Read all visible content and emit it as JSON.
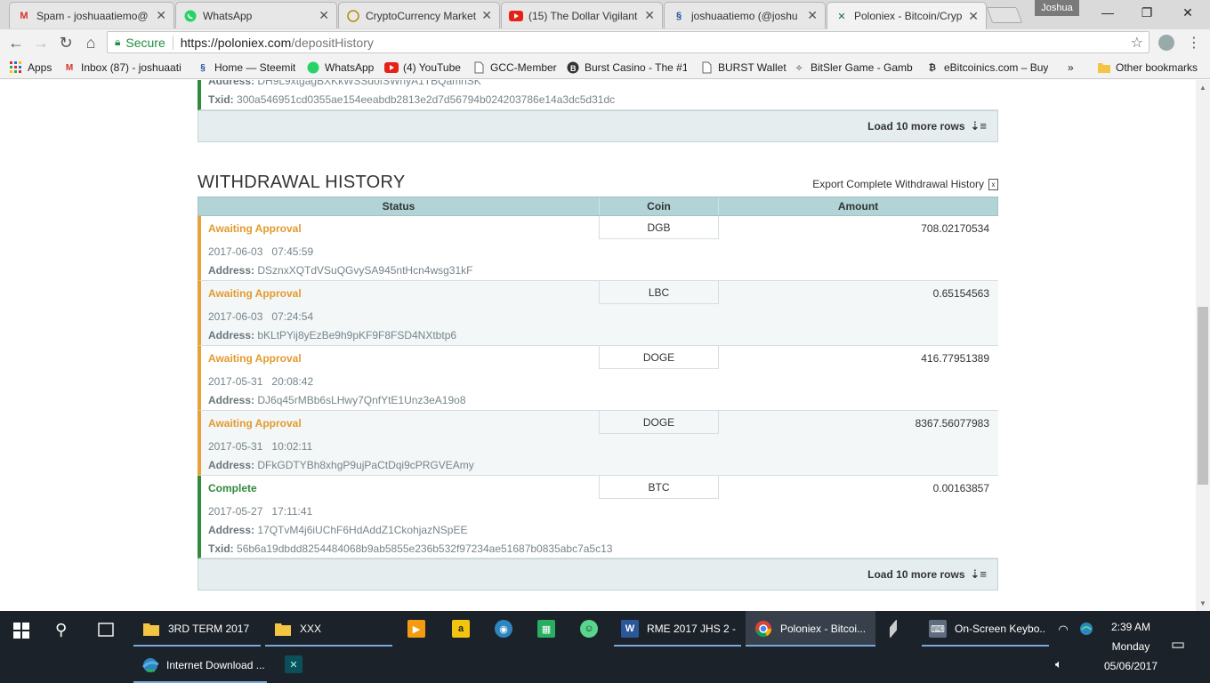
{
  "browser": {
    "tabs": [
      {
        "title": "Spam - joshuaatiemo@",
        "icon": "gmail-icon",
        "color": "#d93025"
      },
      {
        "title": "WhatsApp",
        "icon": "whatsapp-icon",
        "color": "#25d366"
      },
      {
        "title": "CryptoCurrency Market",
        "icon": "coin-icon",
        "color": "#b8860b"
      },
      {
        "title": "(15) The Dollar Vigilant",
        "icon": "youtube-icon",
        "color": "#e62117"
      },
      {
        "title": "joshuaatiemo (@joshu",
        "icon": "steemit-icon",
        "color": "#1a5099"
      },
      {
        "title": "Poloniex - Bitcoin/Cryp",
        "icon": "poloniex-icon",
        "color": "#0b6b6b"
      }
    ],
    "profile_name": "Joshua",
    "address": {
      "secure_label": "Secure",
      "url_host": "https://poloniex.com",
      "url_path": "/depositHistory"
    },
    "bookmarks": [
      {
        "label": "Apps",
        "icon": "apps-grid-icon"
      },
      {
        "label": "Inbox (87) - joshuaati",
        "icon": "gmail-icon"
      },
      {
        "label": "Home — Steemit",
        "icon": "steemit-icon"
      },
      {
        "label": "WhatsApp",
        "icon": "whatsapp-icon"
      },
      {
        "label": "(4) YouTube",
        "icon": "youtube-icon"
      },
      {
        "label": "GCC-Member",
        "icon": "page-icon"
      },
      {
        "label": "Burst Casino - The #1",
        "icon": "burst-casino-icon"
      },
      {
        "label": "BURST Wallet",
        "icon": "page-icon"
      },
      {
        "label": "BitSler Game - Gambl",
        "icon": "bitsler-icon"
      },
      {
        "label": "eBitcoinics.com – Buy",
        "icon": "ebitcoinics-icon"
      },
      {
        "label": "Other bookmarks",
        "icon": "folder-icon"
      }
    ],
    "more_bookmarks": "»"
  },
  "page": {
    "deposit_tail": {
      "address_label": "Address:",
      "address_value": "DH9L9xtgagBXKkWSSdofSWnyA1TBQamnSK",
      "txid_label": "Txid:",
      "txid_value": "300a546951cd0355ae154eeabdb2813e2d7d56794b024203786e14a3dc5d31dc",
      "load_more": "Load 10 more rows"
    },
    "withdrawal": {
      "title": "WITHDRAWAL HISTORY",
      "export_label": "Export Complete Withdrawal History",
      "columns": {
        "status": "Status",
        "coin": "Coin",
        "amount": "Amount"
      },
      "rows": [
        {
          "status": "Awaiting Approval",
          "coin": "DGB",
          "amount": "708.02170534",
          "date": "2017-06-03",
          "time": "07:45:59",
          "address_label": "Address:",
          "address": "DSznxXQTdVSuQGvySA945ntHcn4wsg31kF"
        },
        {
          "status": "Awaiting Approval",
          "coin": "LBC",
          "amount": "0.65154563",
          "date": "2017-06-03",
          "time": "07:24:54",
          "address_label": "Address:",
          "address": "bKLtPYij8yEzBe9h9pKF9F8FSD4NXtbtp6"
        },
        {
          "status": "Awaiting Approval",
          "coin": "DOGE",
          "amount": "416.77951389",
          "date": "2017-05-31",
          "time": "20:08:42",
          "address_label": "Address:",
          "address": "DJ6q45rMBb6sLHwy7QnfYtE1Unz3eA19o8"
        },
        {
          "status": "Awaiting Approval",
          "coin": "DOGE",
          "amount": "8367.56077983",
          "date": "2017-05-31",
          "time": "10:02:11",
          "address_label": "Address:",
          "address": "DFkGDTYBh8xhgP9ujPaCtDqi9cPRGVEAmy"
        },
        {
          "status": "Complete",
          "coin": "BTC",
          "amount": "0.00163857",
          "date": "2017-05-27",
          "time": "17:11:41",
          "address_label": "Address:",
          "address": "17QTvM4j6iUChF6HdAddZ1CkohjazNSpEE",
          "txid_label": "Txid:",
          "txid": "56b6a19dbdd8254484068b9ab5855e236b532f97234ae51687b0835abc7a5c13"
        }
      ],
      "load_more": "Load 10 more rows"
    }
  },
  "taskbar": {
    "items": [
      {
        "label": "3RD TERM 2017",
        "icon": "folder-icon"
      },
      {
        "label": "XXX",
        "icon": "folder-icon"
      },
      {
        "label": "RME 2017 JHS 2 -...",
        "icon": "word-icon"
      },
      {
        "label": "Poloniex - Bitcoi...",
        "icon": "chrome-icon"
      },
      {
        "label": "On-Screen Keybo...",
        "icon": "keyboard-icon"
      },
      {
        "label": "Internet Download ...",
        "icon": "idm-icon"
      }
    ],
    "clock": {
      "time": "2:39 AM",
      "day": "Monday",
      "date": "05/06/2017"
    }
  },
  "colors": {
    "awaiting": "#e39b2d",
    "complete": "#2f8a3b",
    "header_bg": "#b2d4d6"
  }
}
